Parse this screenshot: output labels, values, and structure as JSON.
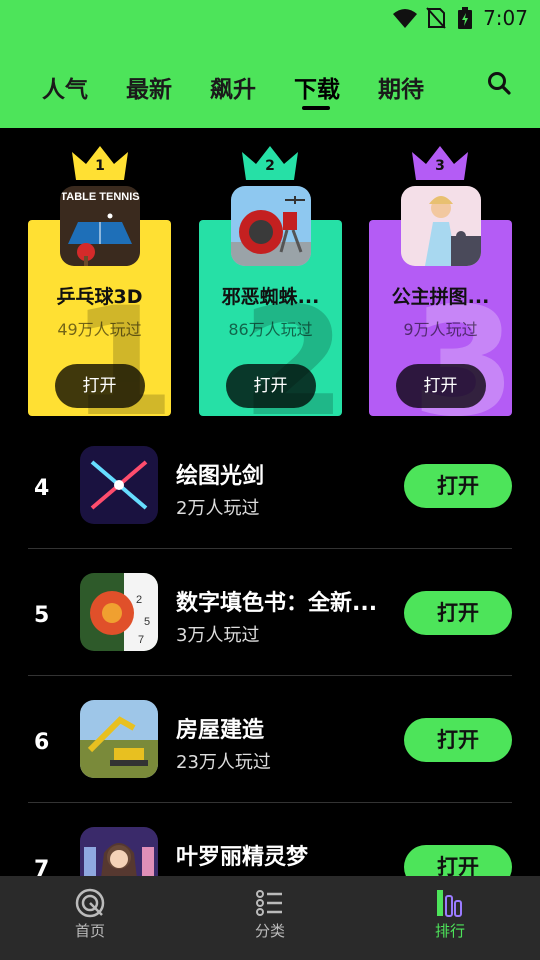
{
  "status": {
    "time": "7:07"
  },
  "tabs": [
    {
      "label": "人气"
    },
    {
      "label": "最新"
    },
    {
      "label": "飙升"
    },
    {
      "label": "下载"
    },
    {
      "label": "期待"
    }
  ],
  "podium": [
    {
      "rank": "1",
      "title": "乒乓球3D",
      "plays": "49万人玩过",
      "button": "打开",
      "color": "#ffe033",
      "bignum": "1"
    },
    {
      "rank": "2",
      "title": "邪恶蜘蛛...",
      "plays": "86万人玩过",
      "button": "打开",
      "color": "#26e0a6",
      "bignum": "2"
    },
    {
      "rank": "3",
      "title": "公主拼图...",
      "plays": "9万人玩过",
      "button": "打开",
      "color": "#b45cf5",
      "bignum": "3"
    }
  ],
  "thumb_text": {
    "table_tennis": "TABLE TENNIS",
    "puzzle_digit_2": "2",
    "puzzle_digit_5": "5",
    "puzzle_digit_7": "7"
  },
  "list": [
    {
      "rank": "4",
      "name": "绘图光剑",
      "plays": "2万人玩过",
      "button": "打开"
    },
    {
      "rank": "5",
      "name": "数字填色书：全新...",
      "plays": "3万人玩过",
      "button": "打开"
    },
    {
      "rank": "6",
      "name": "房屋建造",
      "plays": "23万人玩过",
      "button": "打开"
    },
    {
      "rank": "7",
      "name": "叶罗丽精灵梦",
      "plays": "",
      "button": "打开"
    }
  ],
  "bottom_nav": [
    {
      "label": "首页",
      "icon": "home-icon"
    },
    {
      "label": "分类",
      "icon": "category-icon"
    },
    {
      "label": "排行",
      "icon": "ranking-icon"
    }
  ],
  "colors": {
    "accent": "#4de45a",
    "gold": "#ffe033",
    "teal": "#26e0a6",
    "purple": "#b45cf5"
  }
}
